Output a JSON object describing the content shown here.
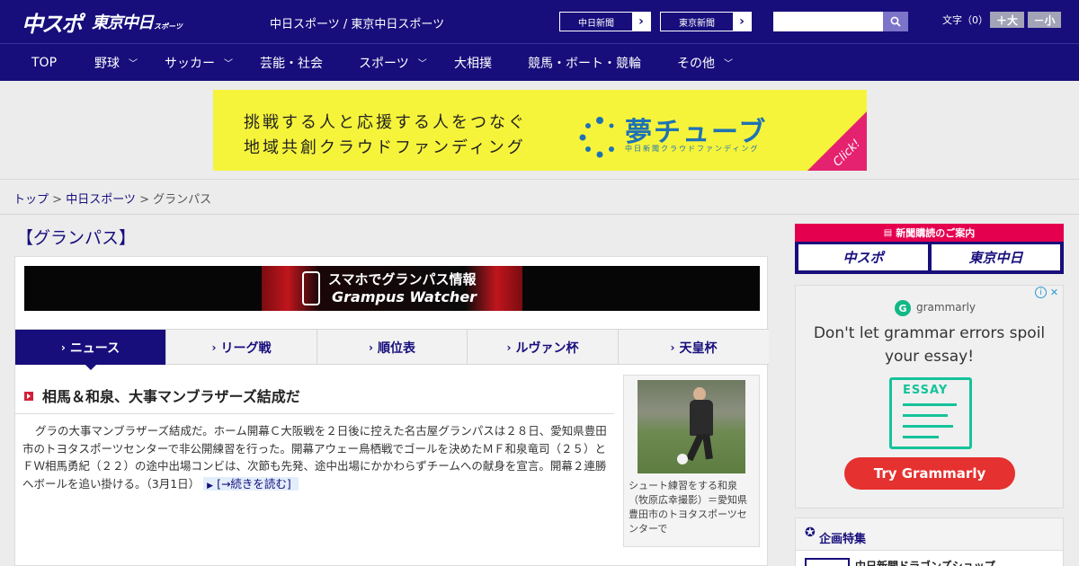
{
  "header": {
    "logo_main": "中スポ",
    "logo_secondary": "東京中日",
    "logo_sub": "スポーツ",
    "site_title": "中日スポーツ / 東京中日スポーツ",
    "link_chunichi": "中日新聞",
    "link_tokyo": "東京新聞",
    "search_placeholder": "",
    "font_label": "文字（0）",
    "font_larger": "＋大",
    "font_smaller": "－小"
  },
  "nav": {
    "items": [
      {
        "label": "TOP",
        "has_menu": false
      },
      {
        "label": "野球",
        "has_menu": true
      },
      {
        "label": "サッカー",
        "has_menu": true
      },
      {
        "label": "芸能・社会",
        "has_menu": false
      },
      {
        "label": "スポーツ",
        "has_menu": true
      },
      {
        "label": "大相撲",
        "has_menu": false
      },
      {
        "label": "競馬・ボート・競輪",
        "has_menu": false
      },
      {
        "label": "その他",
        "has_menu": true
      }
    ]
  },
  "banner": {
    "line1": "挑戦する人と応援する人をつなぐ",
    "line2": "地域共創クラウドファンディング",
    "brand": "夢チューブ",
    "brand_sub": "中日新聞クラウドファンディング",
    "click": "Click!"
  },
  "breadcrumb": {
    "top": "トップ",
    "sep": " > ",
    "parent": "中日スポーツ",
    "current": "グランパス"
  },
  "main": {
    "section_title": "【グランパス】",
    "promo_line1": "スマホでグランパス情報",
    "promo_line2": "Grampus Watcher",
    "tabs": [
      {
        "label": "ニュース",
        "active": true
      },
      {
        "label": "リーグ戦",
        "active": false
      },
      {
        "label": "順位表",
        "active": false
      },
      {
        "label": "ルヴァン杯",
        "active": false
      },
      {
        "label": "天皇杯",
        "active": false
      }
    ],
    "article": {
      "title": "相馬＆和泉、大事マンブラザーズ結成だ",
      "body": "グラの大事マンブラザーズ結成だ。ホーム開幕Ｃ大阪戦を２日後に控えた名古屋グランパスは２８日、愛知県豊田市のトヨタスポーツセンターで非公開練習を行った。開幕アウェー鳥栖戦でゴールを決めたＭＦ和泉竜司（２５）とＦＷ相馬勇紀（２２）の途中出場コンビは、次節も先発、途中出場にかかわらずチームへの献身を宣言。開幕２連勝へボールを追い掛ける。",
      "date": "（3月1日）",
      "more": "[→続きを読む]",
      "caption": "シュート練習をする和泉（牧原広幸撮影）＝愛知県豊田市のトヨタスポーツセンターで"
    }
  },
  "sidebar": {
    "subscribe_title": "新聞購読のご案内",
    "subscribe_a": "中スポ",
    "subscribe_b": "東京中日",
    "ad": {
      "brand": "grammarly",
      "headline": "Don't let grammar errors spoil your essay!",
      "essay_label": "ESSAY",
      "cta": "Try Grammarly"
    },
    "feature_title": "企画特集",
    "feature_item": "中日新聞ドラゴンズショップ"
  },
  "colors": {
    "brand": "#170e7c",
    "accent_red": "#e4004f",
    "banner_yellow": "#f6f43a",
    "grammarly_green": "#15c39a",
    "grammarly_cta": "#e5312f"
  }
}
